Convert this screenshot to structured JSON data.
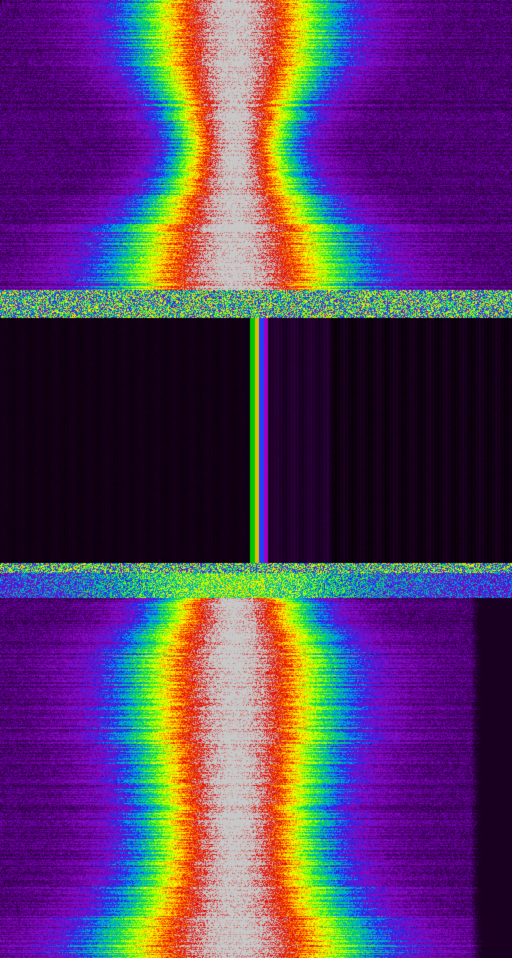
{
  "waterfall": {
    "colormap": [
      "#1a0020",
      "#3a0058",
      "#6a00a0",
      "#8a10c8",
      "#2020e8",
      "#00a0f0",
      "#00d060",
      "#80ff00",
      "#ffff00",
      "#ff8000",
      "#e00000",
      "#c8c8c8"
    ],
    "background_color": "#000000",
    "dead_band_color": "#0d0010",
    "narrow_carrier_colors": [
      "#00c800",
      "#e0c000",
      "#2040ff",
      "#a000c0"
    ],
    "segments": [
      {
        "name": "upper-signal-band",
        "kind": "signal"
      },
      {
        "name": "upper-noise-burst",
        "kind": "noise"
      },
      {
        "name": "quiet-band-with-narrow-carrier",
        "kind": "quiet"
      },
      {
        "name": "lower-noise-burst",
        "kind": "noise"
      },
      {
        "name": "lower-signal-band",
        "kind": "signal"
      }
    ]
  }
}
